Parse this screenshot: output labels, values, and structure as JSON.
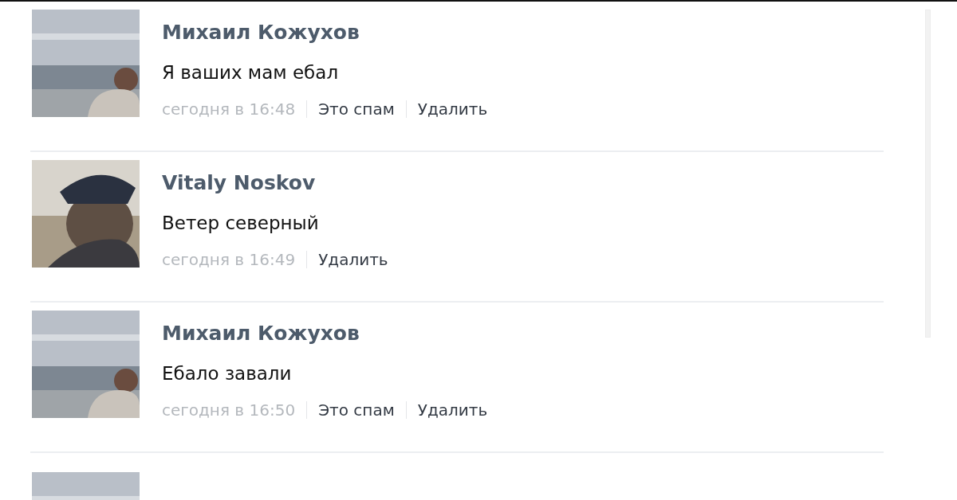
{
  "comments": [
    {
      "avatar": {
        "kind": "picture"
      },
      "author": "Михаил Кожухов",
      "text": "Я ваших мам ебал",
      "time": "сегодня в 16:48",
      "actions": [
        "Это спам",
        "Удалить"
      ]
    },
    {
      "avatar": {
        "kind": "picture"
      },
      "author": "Vitaly Noskov",
      "text": "Ветер северный",
      "time": "сегодня в 16:49",
      "actions": [
        "Удалить"
      ]
    },
    {
      "avatar": {
        "kind": "picture"
      },
      "author": "Михаил Кожухов",
      "text": "Ебало завали",
      "time": "сегодня в 16:50",
      "actions": [
        "Это спам",
        "Удалить"
      ]
    },
    {
      "avatar": {
        "kind": "picture"
      }
    }
  ]
}
